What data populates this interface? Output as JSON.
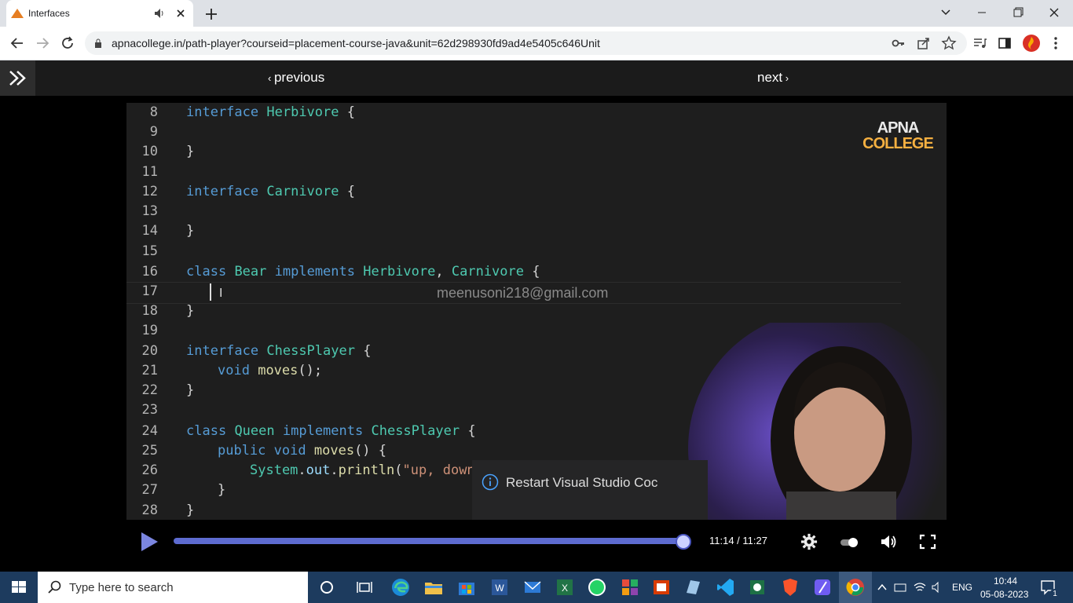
{
  "browser": {
    "tab_title": "Interfaces",
    "url": "apnacollege.in/path-player?courseid=placement-course-java&unit=62d298930fd9ad4e5405c646Unit"
  },
  "player_nav": {
    "previous": "previous",
    "next": "next"
  },
  "video": {
    "logo_line1": "APNA",
    "logo_line2": "COLLEGE",
    "watermark": "meenusoni218@gmail.com",
    "notification": "Restart Visual Studio Coc",
    "line_numbers": [
      "8",
      "9",
      "10",
      "11",
      "12",
      "13",
      "14",
      "15",
      "16",
      "17",
      "18",
      "19",
      "20",
      "21",
      "22",
      "23",
      "24",
      "25",
      "26",
      "27",
      "28"
    ],
    "code_lines": {
      "l8": [
        "interface",
        "Herbivore",
        "{"
      ],
      "l10": "}",
      "l12": [
        "interface",
        "Carnivore",
        "{"
      ],
      "l14": "}",
      "l16": [
        "class",
        "Bear",
        "implements",
        "Herbivore",
        ",",
        "Carnivore",
        "{"
      ],
      "l18": "}",
      "l20": [
        "interface",
        "ChessPlayer",
        "{"
      ],
      "l21": [
        "void",
        "moves",
        "();"
      ],
      "l22": "}",
      "l24": [
        "class",
        "Queen",
        "implements",
        "ChessPlayer",
        "{"
      ],
      "l25": [
        "public",
        "void",
        "moves",
        "() {"
      ],
      "l26": [
        "System",
        ".",
        "out",
        ".",
        "println",
        "(",
        "\"up, down"
      ],
      "l27": "}",
      "l28": "}"
    }
  },
  "controls": {
    "time": "11:14 / 11:27",
    "progress": 0.98
  },
  "taskbar": {
    "search_placeholder": "Type here to search",
    "lang": "ENG",
    "time": "10:44",
    "date": "05-08-2023",
    "notification_count": "1"
  }
}
